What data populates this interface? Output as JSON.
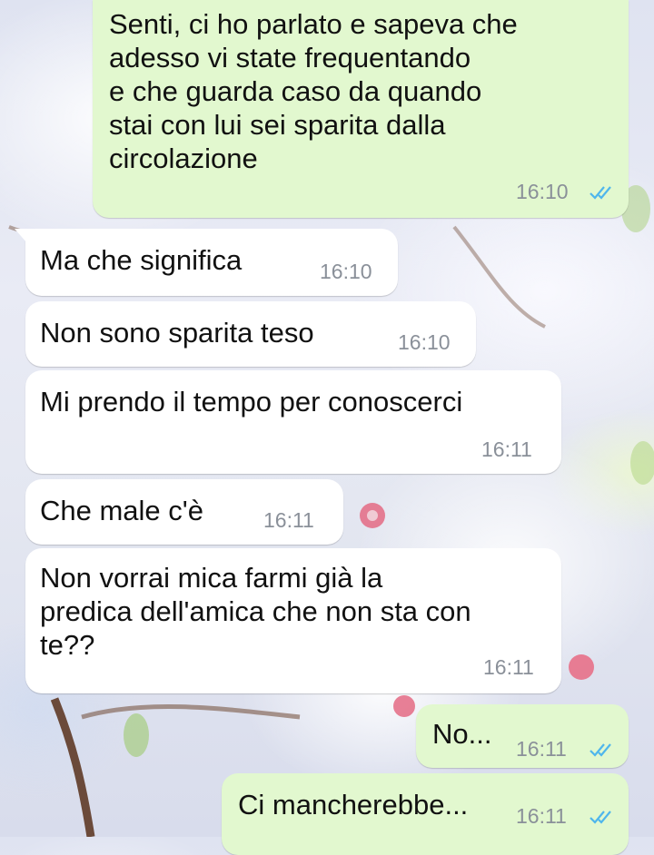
{
  "colors": {
    "incoming_bubble": "#ffffff",
    "outgoing_bubble": "#e2f8cf",
    "timestamp": "#8a9099",
    "read_ticks": "#4fb6ec"
  },
  "messages": [
    {
      "direction": "outgoing",
      "text": "Senti, ci ho parlato e sapeva che\nadesso vi state frequentando\ne che guarda caso da quando\nstai con lui sei sparita dalla\ncircolazione",
      "time": "16:10",
      "status": "read-ticks-icon"
    },
    {
      "direction": "incoming",
      "text": "Ma che significa",
      "time": "16:10"
    },
    {
      "direction": "incoming",
      "text": "Non sono sparita teso",
      "time": "16:10"
    },
    {
      "direction": "incoming",
      "text": "Mi prendo il tempo per conoscerci",
      "time": "16:11"
    },
    {
      "direction": "incoming",
      "text": "Che male c'è",
      "time": "16:11"
    },
    {
      "direction": "incoming",
      "text": "Non vorrai mica farmi già la\npredica dell'amica che non sta con\nte??",
      "time": "16:11"
    },
    {
      "direction": "outgoing",
      "text": "No...",
      "time": "16:11",
      "status": "read-ticks-icon"
    },
    {
      "direction": "outgoing",
      "text": "Ci mancherebbe...",
      "time": "16:11",
      "status": "read-ticks-icon"
    }
  ]
}
